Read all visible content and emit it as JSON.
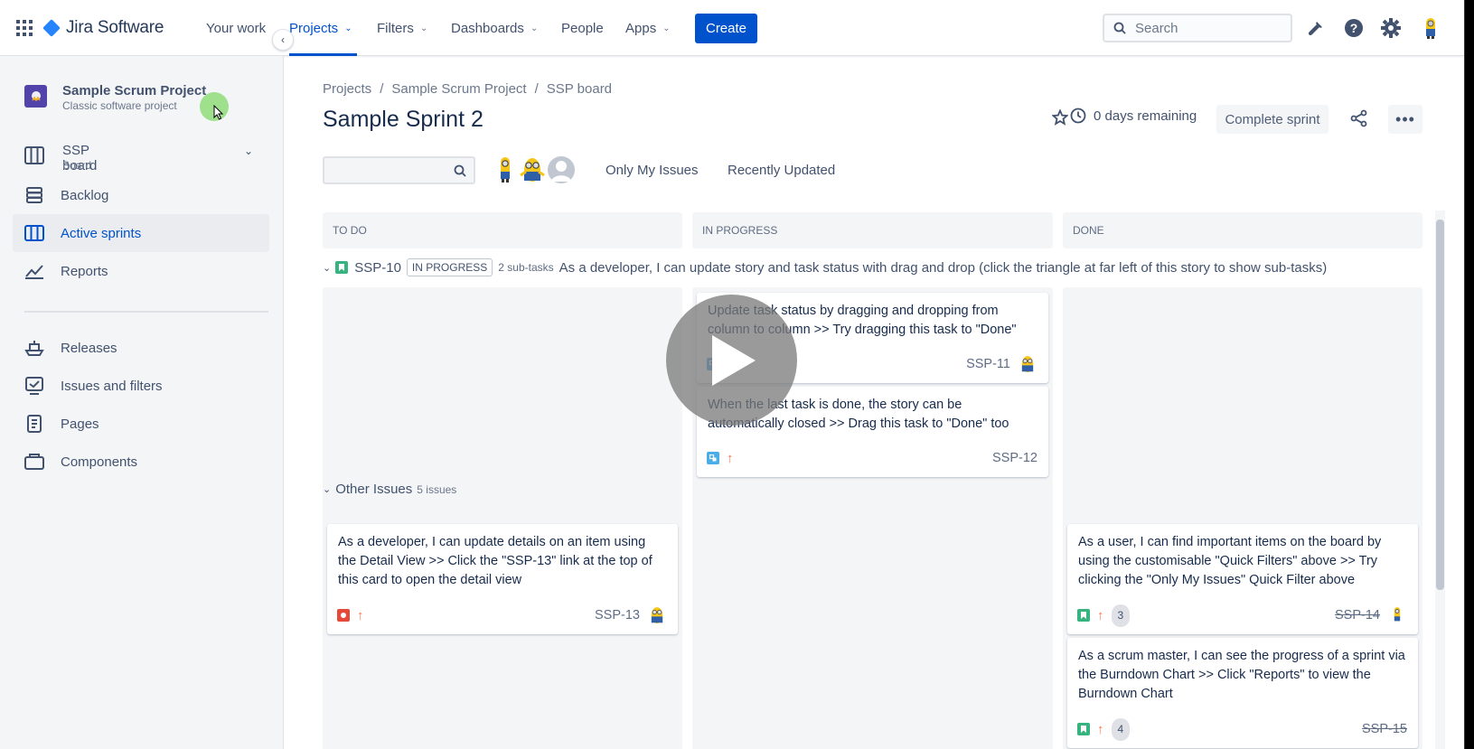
{
  "topnav": {
    "logo": "Jira Software",
    "items": [
      {
        "label": "Your work"
      },
      {
        "label": "Projects"
      },
      {
        "label": "Filters"
      },
      {
        "label": "Dashboards"
      },
      {
        "label": "People"
      },
      {
        "label": "Apps"
      }
    ],
    "create": "Create",
    "search_placeholder": "Search"
  },
  "sidebar": {
    "project_name": "Sample Scrum Project",
    "project_type": "Classic software project",
    "board_title": "SSP board",
    "board_sub": "Board",
    "items": [
      {
        "label": "Backlog"
      },
      {
        "label": "Active sprints"
      },
      {
        "label": "Reports"
      },
      {
        "label": "Releases"
      },
      {
        "label": "Issues and filters"
      },
      {
        "label": "Pages"
      },
      {
        "label": "Components"
      }
    ]
  },
  "main": {
    "breadcrumb": [
      "Projects",
      "/",
      "Sample Scrum Project",
      "/",
      "SSP board"
    ],
    "title": "Sample Sprint 2",
    "days_remaining": "0 days remaining",
    "complete_sprint": "Complete sprint",
    "quick_filters": [
      "Only My Issues",
      "Recently Updated"
    ],
    "columns": [
      "TO DO",
      "IN PROGRESS",
      "DONE"
    ],
    "swimlane": {
      "key": "SSP-10",
      "status": "IN PROGRESS",
      "subtasks": "2 sub-tasks",
      "summary": "As a developer, I can update story and task status with drag and drop (click the triangle at far left of this story to show sub-tasks)"
    },
    "cards_inprogress": [
      {
        "summary": "Update task status by dragging and dropping from column to column >> Try dragging this task to \"Done\"",
        "key": "SSP-11"
      },
      {
        "summary": "When the last task is done, the story can be automatically closed >> Drag this task to \"Done\" too",
        "key": "SSP-12"
      }
    ],
    "other_issues": {
      "label": "Other Issues",
      "count": "5 issues"
    },
    "card_todo": {
      "summary": "As a developer, I can update details on an item using the Detail View >> Click the \"SSP-13\" link at the top of this card to open the detail view",
      "key": "SSP-13"
    },
    "cards_done": [
      {
        "summary": "As a user, I can find important items on the board by using the customisable \"Quick Filters\" above >> Try clicking the \"Only My Issues\" Quick Filter above",
        "points": "3",
        "key": "SSP-14"
      },
      {
        "summary": "As a scrum master, I can see the progress of a sprint via the Burndown Chart >> Click \"Reports\" to view the Burndown Chart",
        "points": "4",
        "key": "SSP-15"
      }
    ]
  },
  "colors": {
    "brand": "#0052cc",
    "story": "#36b37e",
    "bug": "#e5493a",
    "task": "#4bade8",
    "priority": "#ff7452"
  }
}
